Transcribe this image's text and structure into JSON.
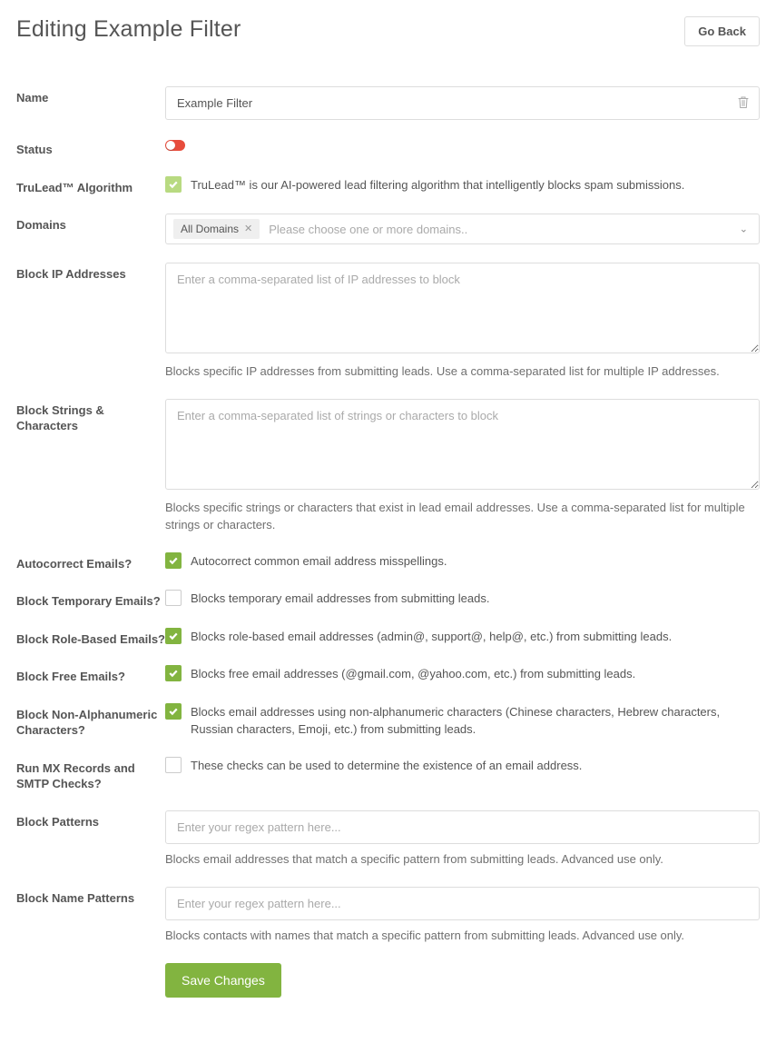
{
  "header": {
    "title": "Editing Example Filter",
    "go_back": "Go Back"
  },
  "form": {
    "name": {
      "label": "Name",
      "value": "Example Filter"
    },
    "status": {
      "label": "Status"
    },
    "trulead": {
      "label": "TruLead™ Algorithm",
      "description": "TruLead™ is our AI-powered lead filtering algorithm that intelligently blocks spam submissions."
    },
    "domains": {
      "label": "Domains",
      "tag": "All Domains",
      "placeholder": "Please choose one or more domains.."
    },
    "block_ips": {
      "label": "Block IP Addresses",
      "placeholder": "Enter a comma-separated list of IP addresses to block",
      "help": "Blocks specific IP addresses from submitting leads. Use a comma-separated list for multiple IP addresses."
    },
    "block_strings": {
      "label": "Block Strings & Characters",
      "placeholder": "Enter a comma-separated list of strings or characters to block",
      "help": "Blocks specific strings or characters that exist in lead email addresses. Use a comma-separated list for multiple strings or characters."
    },
    "autocorrect": {
      "label": "Autocorrect Emails?",
      "description": "Autocorrect common email address misspellings."
    },
    "block_temp": {
      "label": "Block Temporary Emails?",
      "description": "Blocks temporary email addresses from submitting leads."
    },
    "block_role": {
      "label": "Block Role-Based Emails?",
      "description": "Blocks role-based email addresses (admin@, support@, help@, etc.) from submitting leads."
    },
    "block_free": {
      "label": "Block Free Emails?",
      "description": "Blocks free email addresses (@gmail.com, @yahoo.com, etc.) from submitting leads."
    },
    "block_nonalpha": {
      "label": "Block Non-Alphanumeric Characters?",
      "description": "Blocks email addresses using non-alphanumeric characters (Chinese characters, Hebrew characters, Russian characters, Emoji, etc.) from submitting leads."
    },
    "run_mx": {
      "label": "Run MX Records and SMTP Checks?",
      "description": "These checks can be used to determine the existence of an email address."
    },
    "block_patterns": {
      "label": "Block Patterns",
      "placeholder": "Enter your regex pattern here...",
      "help": "Blocks email addresses that match a specific pattern from submitting leads. Advanced use only."
    },
    "block_name_patterns": {
      "label": "Block Name Patterns",
      "placeholder": "Enter your regex pattern here...",
      "help": "Blocks contacts with names that match a specific pattern from submitting leads. Advanced use only."
    }
  },
  "actions": {
    "save": "Save Changes"
  }
}
